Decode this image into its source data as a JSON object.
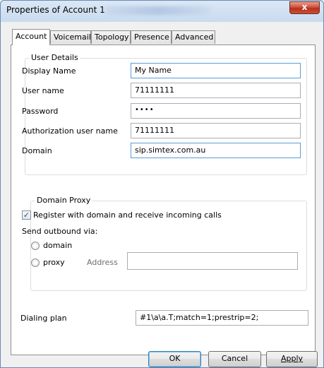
{
  "window": {
    "title": "Properties of Account 1",
    "close_glyph": "x"
  },
  "tabs": [
    {
      "label": "Account",
      "active": true
    },
    {
      "label": "Voicemail",
      "active": false
    },
    {
      "label": "Topology",
      "active": false
    },
    {
      "label": "Presence",
      "active": false
    },
    {
      "label": "Advanced",
      "active": false
    }
  ],
  "user_details": {
    "title": "User Details",
    "display_name": {
      "label": "Display Name",
      "value": "My Name"
    },
    "user_name": {
      "label": "User name",
      "value": "71111111"
    },
    "password": {
      "label": "Password",
      "value": "••••"
    },
    "auth_user_name": {
      "label": "Authorization user name",
      "value": "71111111"
    },
    "domain": {
      "label": "Domain",
      "value": "sip.simtex.com.au"
    }
  },
  "domain_proxy": {
    "title": "Domain Proxy",
    "register_checkbox": {
      "label": "Register with domain and receive incoming calls",
      "checked": true,
      "check_glyph": "✓"
    },
    "send_outbound_label": "Send outbound via:",
    "radio_domain": "domain",
    "radio_proxy": "proxy",
    "address_label": "Address",
    "address_value": ""
  },
  "dialing_plan": {
    "label": "Dialing plan",
    "value": "#1\\a\\a.T;match=1;prestrip=2;"
  },
  "buttons": {
    "ok": "OK",
    "cancel": "Cancel",
    "apply": "Apply"
  },
  "colors": {
    "window_border": "#6a8bb2",
    "close_red": "#c8503a",
    "focus_border": "#5b9bd5",
    "panel_bg": "#f0f0f0"
  }
}
